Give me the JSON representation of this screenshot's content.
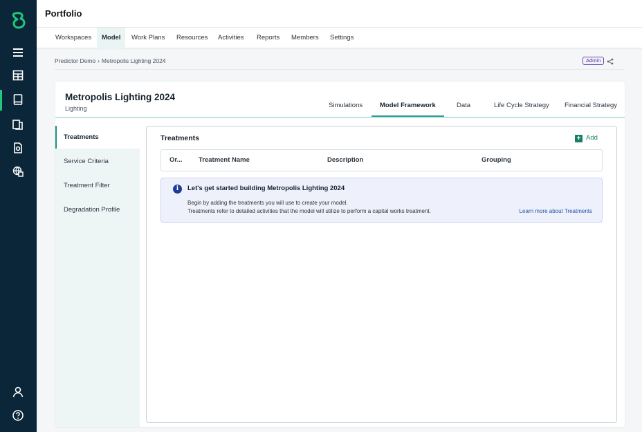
{
  "header": {
    "title": "Portfolio"
  },
  "nav": {
    "items": [
      "Workspaces",
      "Model",
      "Work Plans",
      "Resources",
      "Activities",
      "Reports",
      "Members",
      "Settings"
    ],
    "active": "Model"
  },
  "rail": {
    "icons": [
      "app-logo-icon",
      "menu-icon",
      "table-icon",
      "book-icon",
      "documents-icon",
      "report-icon",
      "globe-settings-icon",
      "user-icon",
      "help-icon"
    ],
    "accent": "#21c77a",
    "background": "#0a2638"
  },
  "breadcrumb": {
    "parent": "Predictor Demo",
    "separator": "›",
    "current": "Metropolis Lighting 2024"
  },
  "badge": {
    "label": "Admin"
  },
  "model": {
    "title": "Metropolis Lighting 2024",
    "subtitle": "Lighting",
    "tabs": [
      "Simulations",
      "Model Framework",
      "Data",
      "Life Cycle Strategy",
      "Financial Strategy"
    ],
    "active_tab": "Model Framework"
  },
  "side_menu": {
    "items": [
      "Treatments",
      "Service Criteria",
      "Treatment Filter",
      "Degradation Profile"
    ],
    "active": "Treatments"
  },
  "treatments": {
    "title": "Treatments",
    "add_label": "Add",
    "columns": [
      "Or...",
      "Treatment Name",
      "Description",
      "Grouping"
    ]
  },
  "info": {
    "icon": "i",
    "title": "Let's get started building Metropolis Lighting 2024",
    "line1": "Begin by adding the treatments you will use to create your model.",
    "line2": "Treatments refer to detailed activities that the model will utilize to perform a capital works treatment.",
    "link": "Learn more about Treatments"
  }
}
